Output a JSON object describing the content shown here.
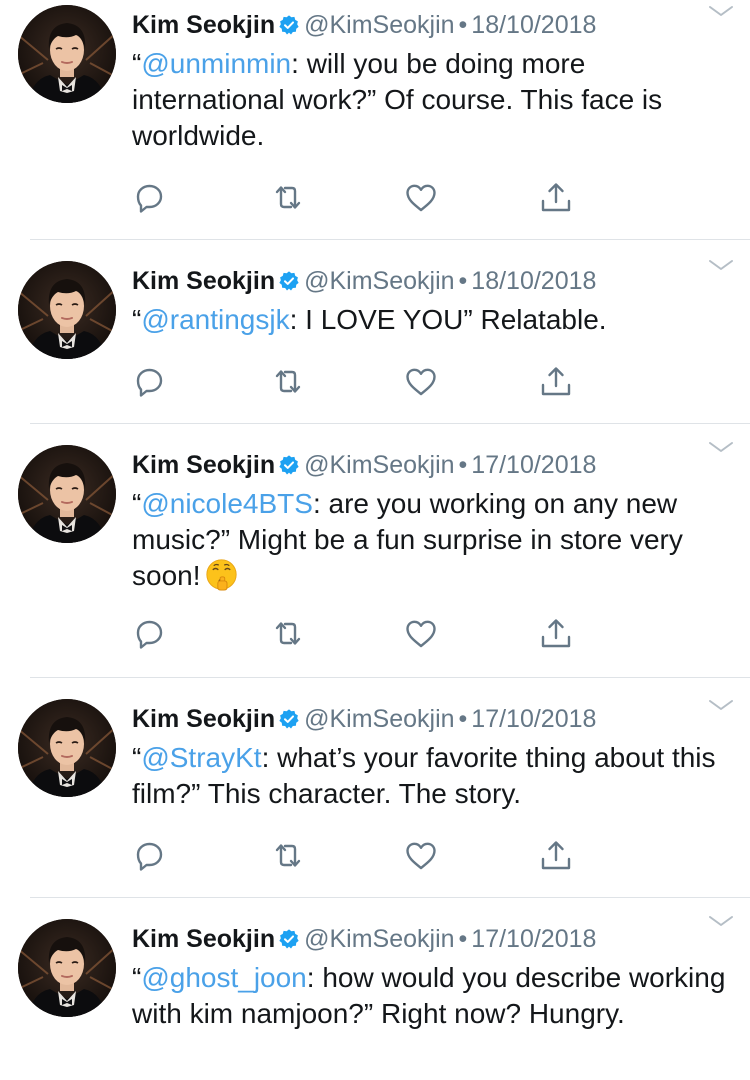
{
  "tweets": [
    {
      "name": "Kim Seokjin",
      "handle": "@KimSeokjin",
      "separator": "•",
      "date": "18/10/2018",
      "open_quote": "“",
      "mention": "@unminmin",
      "text": ": will you be doing more international work?” Of course. This face is worldwide.",
      "emoji": ""
    },
    {
      "name": "Kim Seokjin",
      "handle": "@KimSeokjin",
      "separator": "•",
      "date": "18/10/2018",
      "open_quote": "“",
      "mention": "@rantingsjk",
      "text": ": I LOVE YOU” Relatable.",
      "emoji": ""
    },
    {
      "name": "Kim Seokjin",
      "handle": "@KimSeokjin",
      "separator": "•",
      "date": "17/10/2018",
      "open_quote": "“",
      "mention": "@nicole4BTS",
      "text": ": are you working on any new music?” Might be a fun surprise in store very soon!",
      "emoji": "shushing-face"
    },
    {
      "name": "Kim Seokjin",
      "handle": "@KimSeokjin",
      "separator": "•",
      "date": "17/10/2018",
      "open_quote": "“",
      "mention": "@StrayKt",
      "text": ": what’s your favorite thing about this film?” This character. The story.",
      "emoji": ""
    },
    {
      "name": "Kim Seokjin",
      "handle": "@KimSeokjin",
      "separator": "•",
      "date": "17/10/2018",
      "open_quote": "“",
      "mention": "@ghost_joon",
      "text": ": how would you describe working with kim namjoon?” Right now? Hungry.",
      "emoji": ""
    }
  ],
  "icons": {
    "reply": "reply-icon",
    "retweet": "retweet-icon",
    "like": "like-icon",
    "share": "share-icon",
    "verified": "verified-badge-icon",
    "caret": "chevron-down-icon"
  },
  "colors": {
    "text": "#14171a",
    "secondary": "#657786",
    "mention": "#4aa1e8",
    "verified": "#1da1f2",
    "icon": "#657786",
    "divider": "#dfe3e7"
  }
}
